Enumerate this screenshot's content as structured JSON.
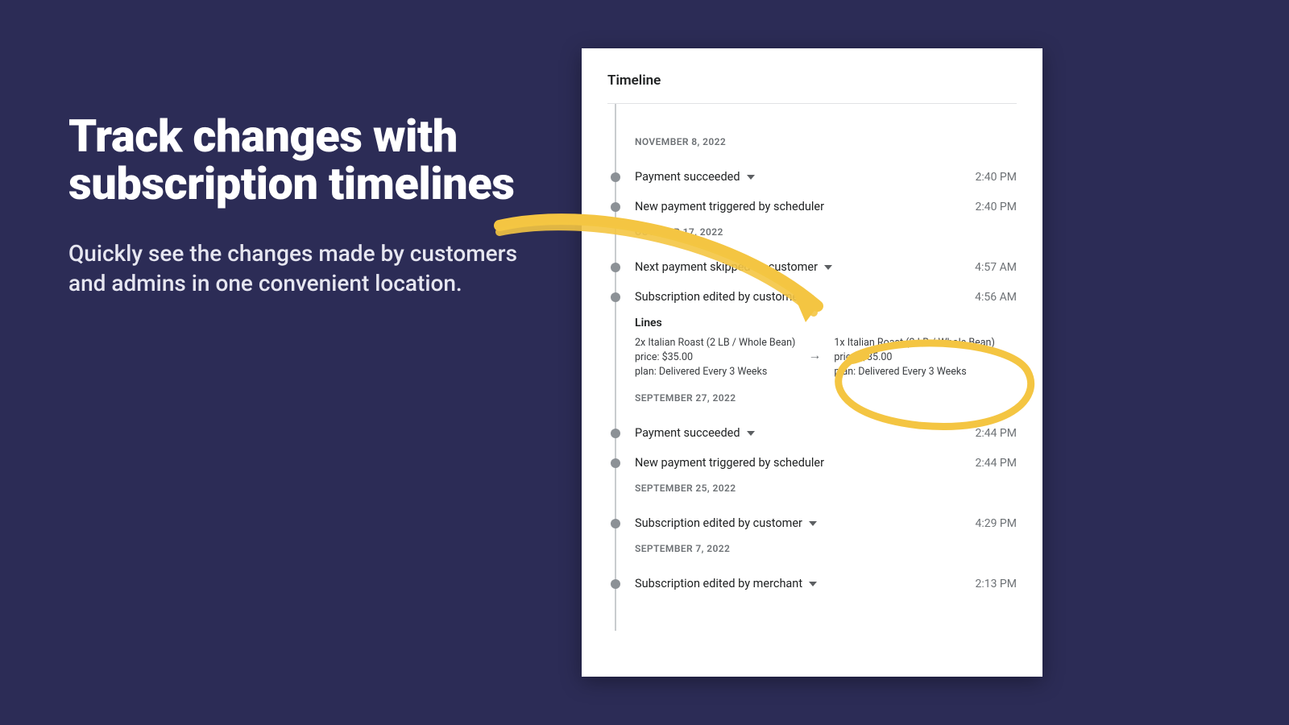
{
  "hero": {
    "title": "Track changes with subscription timelines",
    "subtitle": "Quickly see the changes made by customers and admins in one convenient location."
  },
  "panel": {
    "title": "Timeline"
  },
  "dates": {
    "d1": "NOVEMBER 8, 2022",
    "d2": "OCTOBER 17, 2022",
    "d3": "SEPTEMBER 27, 2022",
    "d4": "SEPTEMBER 25, 2022",
    "d5": "SEPTEMBER 7, 2022"
  },
  "events": {
    "e1": {
      "label": "Payment succeeded",
      "time": "2:40 PM"
    },
    "e2": {
      "label": "New payment triggered by scheduler",
      "time": "2:40 PM"
    },
    "e3": {
      "label": "Next payment skipped by customer",
      "time": "4:57 AM"
    },
    "e4": {
      "label": "Subscription edited by customer",
      "time": "4:56 AM"
    },
    "e5": {
      "label": "Payment succeeded",
      "time": "2:44 PM"
    },
    "e6": {
      "label": "New payment triggered by scheduler",
      "time": "2:44 PM"
    },
    "e7": {
      "label": "Subscription edited by customer",
      "time": "4:29 PM"
    },
    "e8": {
      "label": "Subscription edited by merchant",
      "time": "2:13 PM"
    }
  },
  "detail": {
    "heading": "Lines",
    "before": {
      "l1": "2x Italian Roast (2 LB / Whole Bean)",
      "l2": "price: $35.00",
      "l3": "plan: Delivered Every 3 Weeks"
    },
    "after": {
      "l1": "1x Italian Roast (2 LB / Whole Bean)",
      "l2": "price: $35.00",
      "l3": "plan: Delivered Every 3 Weeks"
    }
  },
  "annotations": {
    "color": "#f4c542"
  }
}
